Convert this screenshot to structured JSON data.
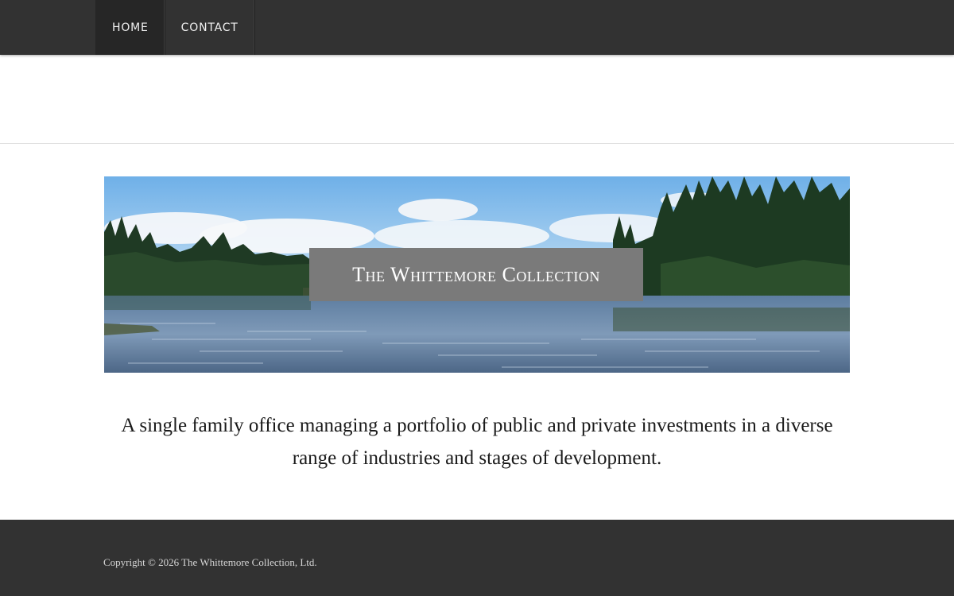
{
  "nav": {
    "items": [
      {
        "label": "HOME",
        "active": true
      },
      {
        "label": "CONTACT",
        "active": false
      }
    ]
  },
  "banner": {
    "title": "The Whittemore Collection",
    "icon": "lake-landscape-image"
  },
  "main": {
    "tagline": "A single family office managing a portfolio of public and private investments in a diverse range of industries and stages of development."
  },
  "footer": {
    "copyright": "Copyright © 2026 The Whittemore Collection, Ltd."
  },
  "colors": {
    "nav_bg": "#323232",
    "nav_active_bg": "#262626",
    "footer_bg": "#323232",
    "text": "#1a1a1a"
  }
}
